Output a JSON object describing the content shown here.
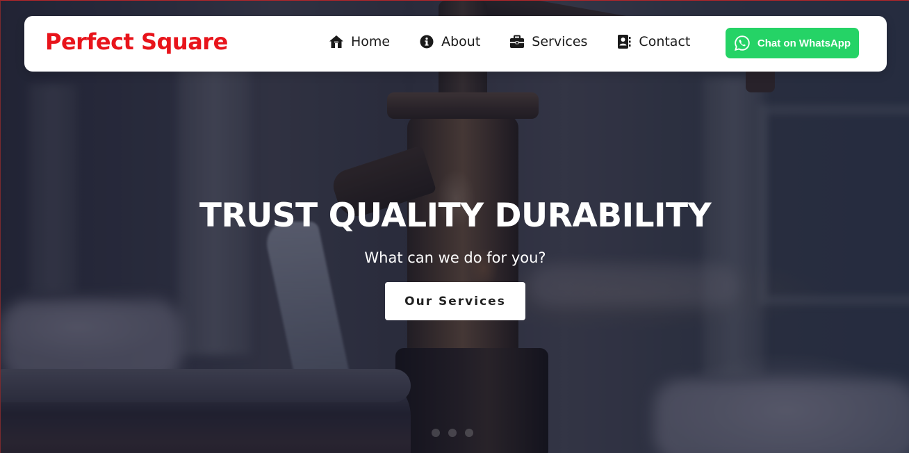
{
  "brand": {
    "name": "Perfect Square",
    "color": "#e8141b"
  },
  "nav": {
    "items": [
      {
        "label": "Home",
        "icon": "home-icon"
      },
      {
        "label": "About",
        "icon": "info-icon"
      },
      {
        "label": "Services",
        "icon": "briefcase-icon"
      },
      {
        "label": "Contact",
        "icon": "contact-book-icon"
      }
    ]
  },
  "whatsapp": {
    "label": "Chat on WhatsApp",
    "icon": "whatsapp-icon",
    "color": "#25d366"
  },
  "hero": {
    "title": "TRUST QUALITY DURABILITY",
    "subtitle": "What can we do for you?",
    "cta_label": "Our Services"
  },
  "carousel": {
    "slides": 3,
    "active": 0
  }
}
